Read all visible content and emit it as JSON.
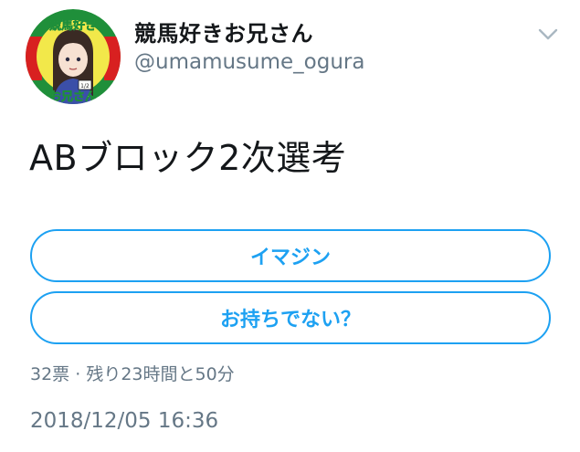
{
  "user": {
    "display_name": "競馬好きお兄さん",
    "handle": "@umamusume_ogura",
    "avatar_text_top": "競馬好き",
    "avatar_text_bottom": "お兄さん",
    "avatar_badge": "1/2"
  },
  "tweet": {
    "text": "ABブロック2次選考"
  },
  "poll": {
    "options": [
      {
        "label": "イマジン"
      },
      {
        "label": "お持ちでない？"
      }
    ],
    "votes": "32票",
    "separator": "·",
    "remaining": "残り23時間と50分"
  },
  "timestamp": "2018/12/05 16:36",
  "icons": {
    "menu": "chevron-down-icon"
  },
  "colors": {
    "accent": "#1da1f2",
    "text_primary": "#14171a",
    "text_secondary": "#657786"
  }
}
